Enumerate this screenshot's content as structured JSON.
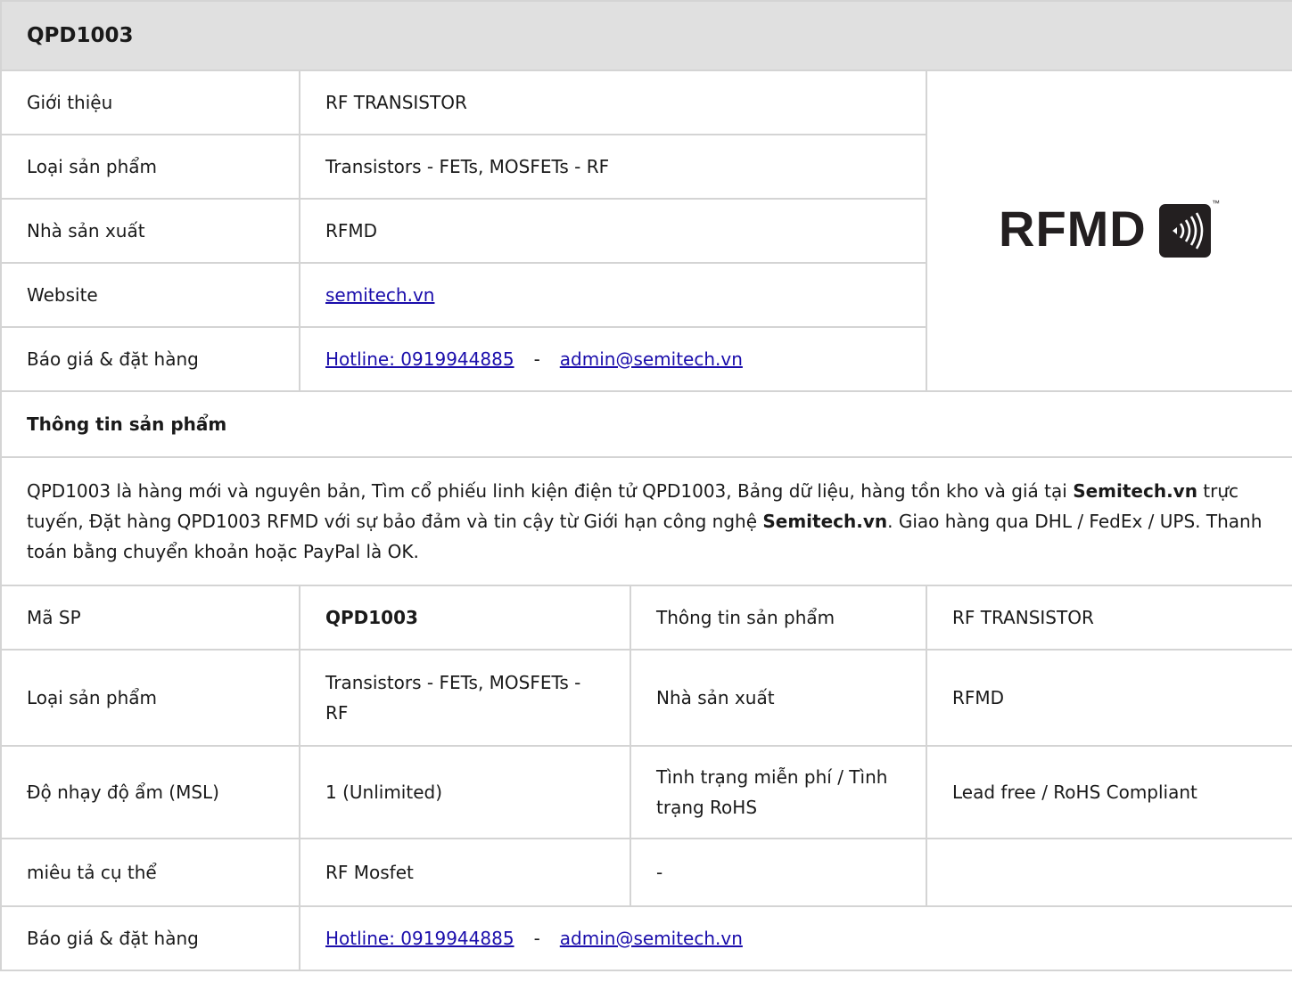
{
  "title": "QPD1003",
  "top": {
    "rows": [
      {
        "label": "Giới thiệu",
        "value": "RF TRANSISTOR"
      },
      {
        "label": "Loại sản phẩm",
        "value": "Transistors - FETs, MOSFETs - RF"
      },
      {
        "label": "Nhà sản xuất",
        "value": "RFMD"
      },
      {
        "label": "Website",
        "link": "semitech.vn"
      },
      {
        "label": "Báo giá & đặt hàng",
        "hotline": "Hotline: 0919944885",
        "dash": "-",
        "email": "admin@semitech.vn"
      }
    ],
    "logo": {
      "text": "RFMD",
      "icon": "radio-waves-icon",
      "tm": "™"
    }
  },
  "info": {
    "heading": "Thông tin sản phẩm",
    "desc_part1": "QPD1003 là hàng mới và nguyên bản, Tìm cổ phiếu linh kiện điện tử QPD1003, Bảng dữ liệu, hàng tồn kho và giá tại ",
    "desc_bold1": "Semitech.vn",
    "desc_part2": " trực tuyến, Đặt hàng QPD1003 RFMD với sự bảo đảm và tin cậy từ Giới hạn công nghệ ",
    "desc_bold2": "Semitech.vn",
    "desc_part3": ". Giao hàng qua DHL / FedEx / UPS. Thanh toán bằng chuyển khoản hoặc PayPal là OK."
  },
  "details": {
    "r1": {
      "c1": "Mã SP",
      "c2": "QPD1003",
      "c3": "Thông tin sản phẩm",
      "c4": "RF TRANSISTOR"
    },
    "r2": {
      "c1": "Loại sản phẩm",
      "c2": "Transistors - FETs, MOSFETs - RF",
      "c3": "Nhà sản xuất",
      "c4": "RFMD"
    },
    "r3": {
      "c1": "Độ nhạy độ ẩm (MSL)",
      "c2": "1 (Unlimited)",
      "c3": "Tình trạng miễn phí / Tình trạng RoHS",
      "c4": "Lead free / RoHS Compliant"
    },
    "r4": {
      "c1": "miêu tả cụ thể",
      "c2": "RF Mosfet",
      "c3": "-",
      "c4": ""
    },
    "r5": {
      "c1": "Báo giá & đặt hàng",
      "hotline": "Hotline: 0919944885",
      "dash": "-",
      "email": "admin@semitech.vn"
    }
  },
  "colors": {
    "header_bg": "#e0e0e0",
    "border": "#d4d4d4",
    "link": "#1a0dab",
    "logo": "#231f20"
  }
}
